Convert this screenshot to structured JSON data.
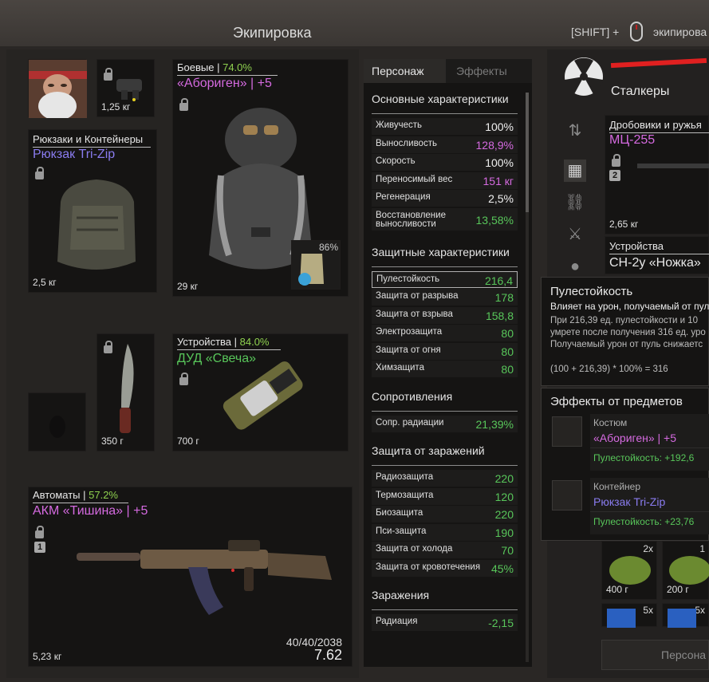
{
  "header": {
    "title": "Экипировка",
    "shift_hint": "[SHIFT] +",
    "shift_action": "экипирова"
  },
  "slots": {
    "helmet": {
      "weight": "1,25 кг"
    },
    "backpack": {
      "category": "Рюкзаки и Контейнеры",
      "name": "Рюкзак Tri-Zip",
      "weight": "2,5 кг"
    },
    "armor": {
      "category": "Боевые",
      "percent": "74.0%",
      "name": "«Абориген» | +5",
      "weight": "29 кг",
      "container_percent": "86%"
    },
    "knife": {
      "weight": "350 г"
    },
    "device": {
      "category": "Устройства",
      "percent": "84.0%",
      "name": "ДУД «Свеча»",
      "weight": "700 г"
    },
    "rifle": {
      "category": "Автоматы",
      "percent": "57.2%",
      "name": "АКМ «Тишина» | +5",
      "slot_number": "1",
      "weight": "5,23 кг",
      "ammo": "40/40/2038",
      "dps": "7.62"
    }
  },
  "stats": {
    "tabs": [
      "Персонаж",
      "Эффекты"
    ],
    "sections": [
      {
        "title": "Основные характеристики",
        "rows": [
          {
            "label": "Живучесть",
            "value": "100%",
            "color": "#f0f0f0"
          },
          {
            "label": "Выносливость",
            "value": "128,9%",
            "color": "#d56ae0"
          },
          {
            "label": "Скорость",
            "value": "100%",
            "color": "#f0f0f0"
          },
          {
            "label": "Переносимый вес",
            "value": "151 кг",
            "color": "#d56ae0"
          },
          {
            "label": "Регенерация",
            "value": "2,5%",
            "color": "#f0f0f0"
          },
          {
            "label": "Восстановление выносливости",
            "value": "13,58%",
            "color": "#58c65a"
          }
        ]
      },
      {
        "title": "Защитные характеристики",
        "rows": [
          {
            "label": "Пулестойкость",
            "value": "216,4",
            "color": "#58c65a"
          },
          {
            "label": "Защита от разрыва",
            "value": "178",
            "color": "#58c65a"
          },
          {
            "label": "Защита от взрыва",
            "value": "158,8",
            "color": "#58c65a"
          },
          {
            "label": "Электрозащита",
            "value": "80",
            "color": "#58c65a"
          },
          {
            "label": "Защита от огня",
            "value": "80",
            "color": "#58c65a"
          },
          {
            "label": "Химзащита",
            "value": "80",
            "color": "#58c65a"
          }
        ]
      },
      {
        "title": "Сопротивления",
        "rows": [
          {
            "label": "Сопр. радиации",
            "value": "21,39%",
            "color": "#58c65a"
          }
        ]
      },
      {
        "title": "Защита от заражений",
        "rows": [
          {
            "label": "Радиозащита",
            "value": "220",
            "color": "#58c65a"
          },
          {
            "label": "Термозащита",
            "value": "120",
            "color": "#58c65a"
          },
          {
            "label": "Биозащита",
            "value": "220",
            "color": "#58c65a"
          },
          {
            "label": "Пси-защита",
            "value": "190",
            "color": "#58c65a"
          },
          {
            "label": "Защита от холода",
            "value": "70",
            "color": "#58c65a"
          },
          {
            "label": "Защита от кровотечения",
            "value": "45%",
            "color": "#58c65a"
          }
        ]
      },
      {
        "title": "Заражения",
        "rows": [
          {
            "label": "Радиация",
            "value": "-2,15",
            "color": "#58c65a"
          }
        ]
      }
    ]
  },
  "right": {
    "faction": "Сталкеры",
    "shotgun": {
      "category": "Дробовики и ружья",
      "name": "МЦ-255",
      "slot_number": "2",
      "weight": "2,65 кг"
    },
    "device2": {
      "category": "Устройства",
      "name": "СН-2у «Ножка»"
    },
    "stack1": {
      "count": "2x",
      "weight": "400 г"
    },
    "stack2": {
      "count": "1",
      "weight": "200 г"
    },
    "stack3": {
      "count": "5x"
    },
    "stack4": {
      "count": "5x"
    },
    "bottom_button": "Персона"
  },
  "tooltip": {
    "title": "Пулестойкость",
    "subtitle": "Влияет на урон, получаемый от пуль",
    "body": [
      "При 216,39 ед. пулестойкости и 10",
      "умрете после получения 316 ед. уро",
      "Получаемый урон от пуль снижаетс"
    ],
    "formula": "(100 + 216,39) * 100% = 316"
  },
  "effects": {
    "title": "Эффекты от предметов",
    "items": [
      {
        "type": "Костюм",
        "name": "«Абориген» | +5",
        "bonus": "Пулестойкость: +192,6"
      },
      {
        "type": "Контейнер",
        "name": "Рюкзак Tri-Zip",
        "bonus": "Пулестойкость: +23,76"
      }
    ]
  }
}
